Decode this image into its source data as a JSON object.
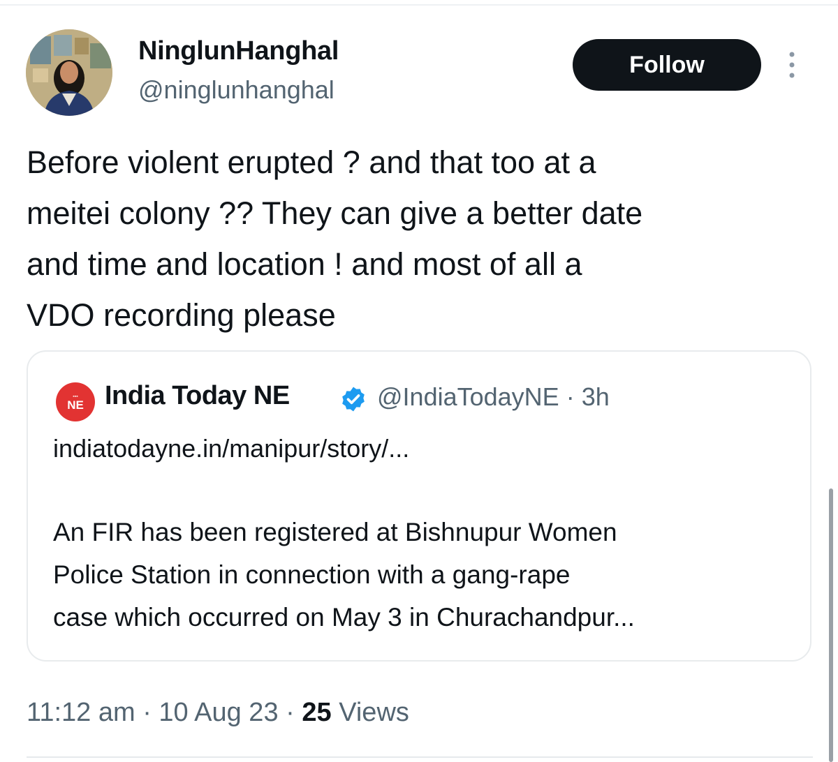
{
  "author": {
    "display_name": "NinglunHanghal",
    "handle": "@ninglunhanghal",
    "avatar": "profile-photo"
  },
  "actions": {
    "follow_label": "Follow",
    "more_icon": "more-vertical-icon"
  },
  "tweet": {
    "text": "Before violent erupted ? and that too at a\nmeitei colony ?? They can give a better date\nand time and location ! and most of all a\nVDO recording please"
  },
  "quote": {
    "logo_text": "NE",
    "name": "India Today NE",
    "verified_icon": "verified-badge-icon",
    "handle": "@IndiaTodayNE",
    "separator": "·",
    "time": "3h",
    "link": "indiatodayne.in/manipur/story/...",
    "text": "An FIR has been registered at Bishnupur Women\nPolice Station in connection with a gang-rape\ncase which occurred on May 3 in Churachandpur..."
  },
  "meta": {
    "time": "11:12 am",
    "date": "10 Aug 23",
    "separator": "·",
    "views_count": "25",
    "views_label": "Views"
  },
  "colors": {
    "text": "#0f1419",
    "secondary": "#536471",
    "follow_bg": "#0f1419",
    "verified": "#1d9bf0",
    "logo_red": "#e23332"
  }
}
